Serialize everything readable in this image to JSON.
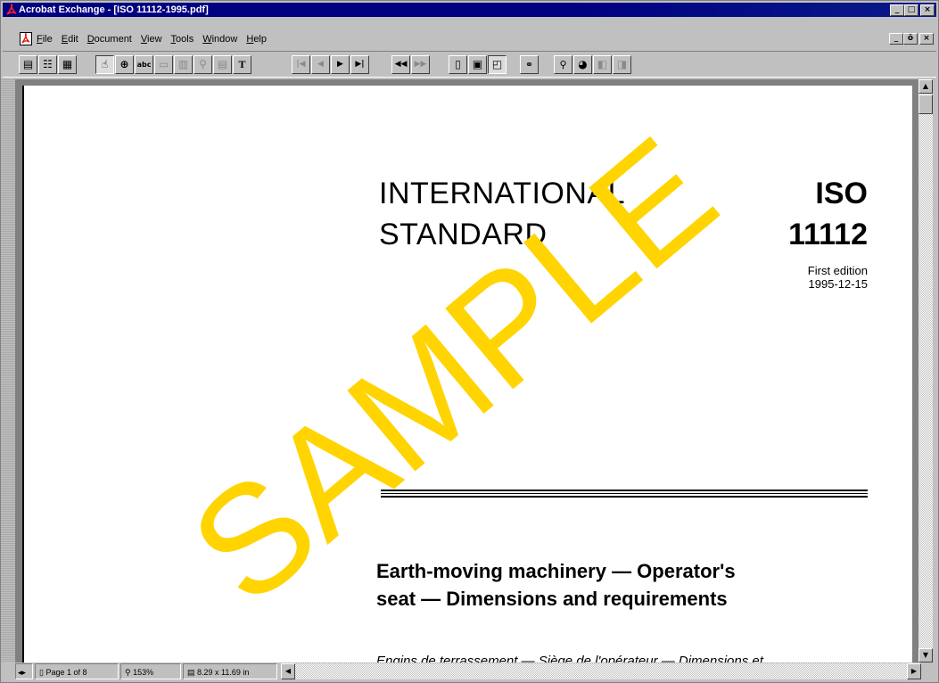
{
  "window": {
    "title": "Acrobat Exchange - [ISO 11112-1995.pdf]",
    "controls": [
      "_",
      "□",
      "×"
    ],
    "mdi_controls": [
      "_",
      "ŏ",
      "×"
    ]
  },
  "menu": [
    "File",
    "Edit",
    "Document",
    "View",
    "Tools",
    "Window",
    "Help"
  ],
  "toolbar": {
    "groups": [
      [
        "page-only-icon",
        "bookmarks-and-page-icon",
        "thumbnails-and-page-icon"
      ],
      [
        "hand-tool-icon",
        "zoom-tool-icon",
        "text-select-icon",
        "graphics-select-icon",
        "column-select-icon",
        "link-tool-icon",
        "note-tool-icon",
        "text-touchup-icon"
      ],
      [
        "first-page-icon",
        "previous-page-icon",
        "next-page-icon",
        "last-page-icon"
      ],
      [
        "go-back-icon",
        "go-forward-icon"
      ],
      [
        "actual-size-icon",
        "fit-page-icon",
        "fit-width-icon"
      ],
      [
        "find-icon"
      ],
      [
        "search-icon",
        "search-results-icon",
        "previous-highlight-icon",
        "next-highlight-icon"
      ]
    ]
  },
  "document": {
    "title_line1": "INTERNATIONAL",
    "title_line2": "STANDARD",
    "iso_label": "ISO",
    "iso_number": "11112",
    "edition": "First edition",
    "date": "1995-12-15",
    "heading_line1": "Earth-moving machinery — Operator's",
    "heading_line2": "seat — Dimensions and requirements",
    "subtitle_fr": "Engins de terrassement — Siège de l'opérateur — Dimensions et",
    "watermark": "SAMPLE",
    "watermark_color": "#ffd400"
  },
  "status": {
    "page": "Page 1 of 8",
    "zoom": "153%",
    "page_size": "8.29 x 11.69 in"
  }
}
